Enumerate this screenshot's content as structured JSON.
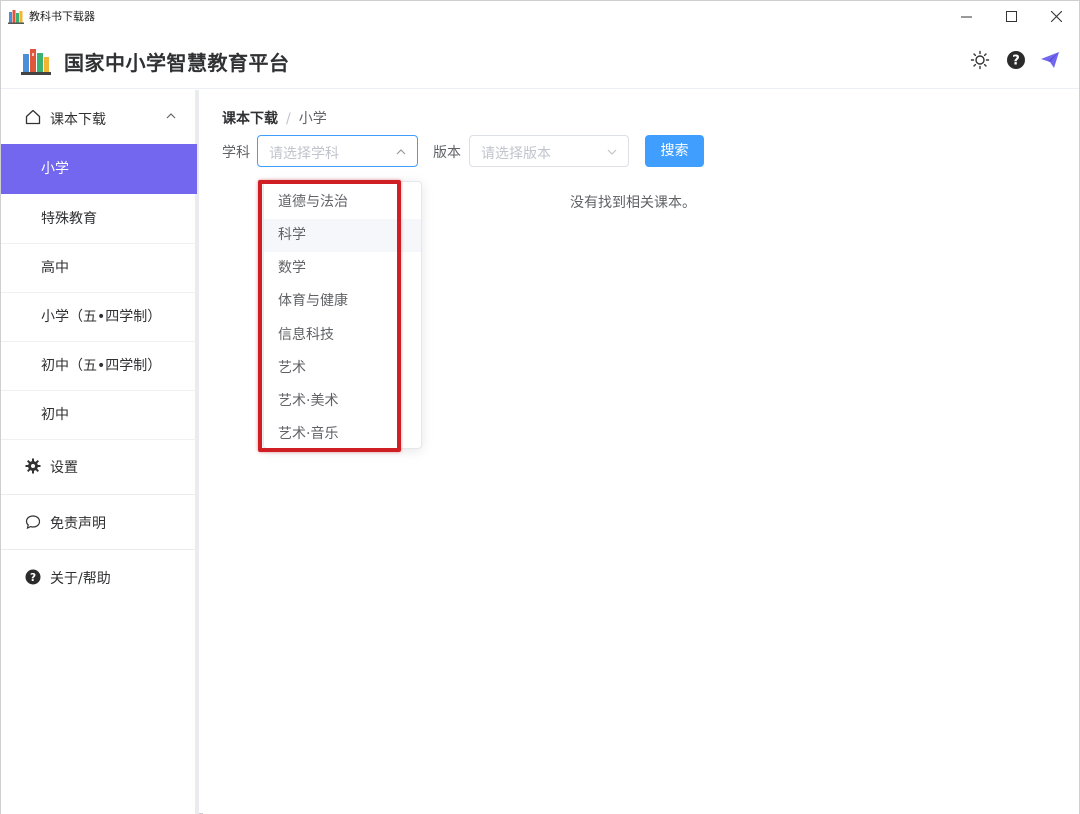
{
  "window": {
    "title": "教科书下载器"
  },
  "header": {
    "brand": "国家中小学智慧教育平台"
  },
  "sidebar": {
    "group_label": "课本下载",
    "subitems": [
      "小学",
      "特殊教育",
      "高中",
      "小学（五•四学制）",
      "初中（五•四学制）",
      "初中"
    ],
    "active_index": 0,
    "items": [
      {
        "label": "设置",
        "icon": "gear-icon"
      },
      {
        "label": "免责声明",
        "icon": "chat-bubble-icon"
      },
      {
        "label": "关于/帮助",
        "icon": "help-icon"
      }
    ]
  },
  "breadcrumb": {
    "root": "课本下载",
    "separator": "/",
    "current": "小学"
  },
  "filters": {
    "subject_label": "学科",
    "subject_placeholder": "请选择学科",
    "version_label": "版本",
    "version_placeholder": "请选择版本",
    "search_label": "搜索"
  },
  "empty_message": "没有找到相关课本。",
  "dropdown": {
    "options": [
      "道德与法治",
      "科学",
      "数学",
      "体育与健康",
      "信息科技",
      "艺术",
      "艺术·美术",
      "艺术·音乐"
    ],
    "hover_index": 1
  },
  "colors": {
    "accent": "#7367f0",
    "primary_button": "#409eff",
    "highlight_box": "#d01f24"
  }
}
